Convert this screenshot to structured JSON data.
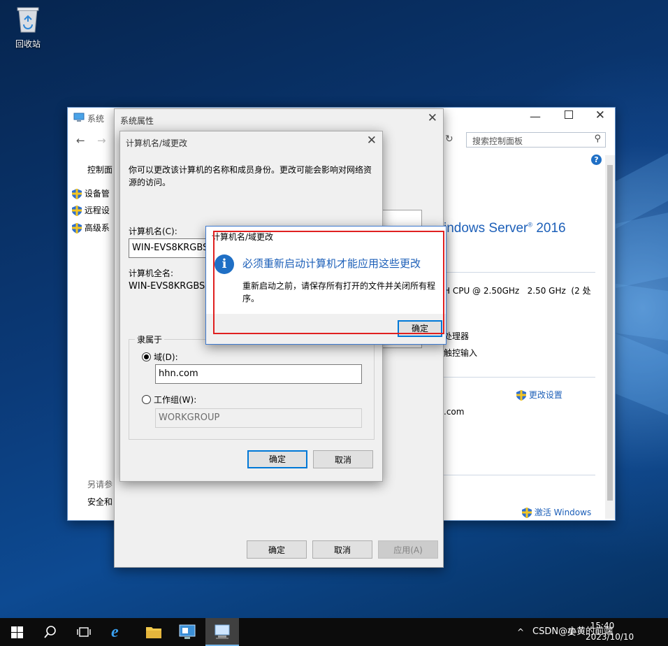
{
  "desktop": {
    "recycle_bin_label": "回收站"
  },
  "control_panel": {
    "title": "系统",
    "search_placeholder": "搜索控制面板",
    "nav_home": "控制面",
    "links": [
      "设备管",
      "远程设",
      "高级系"
    ],
    "see_also": "另请参",
    "security": "安全和",
    "os_name": "indows Server",
    "os_version": "2016",
    "os_sup": "®",
    "cpu_text": "H CPU @ 2.50GHz   2.50 GHz  (2 处",
    "processor_text": "处理器",
    "touch_text": "触控输入",
    "change_settings": "更改设置",
    "domain_suffix": ".com",
    "activate": "激活 Windows"
  },
  "system_properties": {
    "title": "系统属性",
    "ok": "确定",
    "cancel": "取消",
    "apply": "应用(A)"
  },
  "computer_name_dialog": {
    "title": "计算机名/域更改",
    "description": "你可以更改该计算机的名称和成员身份。更改可能会影响对网络资源的访问。",
    "computer_name_label": "计算机名(C):",
    "computer_name_value": "WIN-EVS8KRGBS3",
    "full_name_label": "计算机全名:",
    "full_name_value": "WIN-EVS8KRGBS3",
    "member_of": "隶属于",
    "domain_label": "域(D):",
    "domain_value": "hhn.com",
    "workgroup_label": "工作组(W):",
    "workgroup_value": "WORKGROUP",
    "ok": "确定",
    "cancel": "取消"
  },
  "message_box": {
    "title": "计算机名/域更改",
    "heading": "必须重新启动计算机才能应用这些更改",
    "body": "重新启动之前，请保存所有打开的文件并关闭所有程序。",
    "ok": "确定"
  },
  "taskbar": {
    "tray_text": "CSDN@小黄的前端",
    "time": "15:40",
    "date": "2023/10/10",
    "lang": "英"
  },
  "colors": {
    "accent": "#0078d7",
    "highlight": "#e02020",
    "heading": "#1c5fb8"
  }
}
